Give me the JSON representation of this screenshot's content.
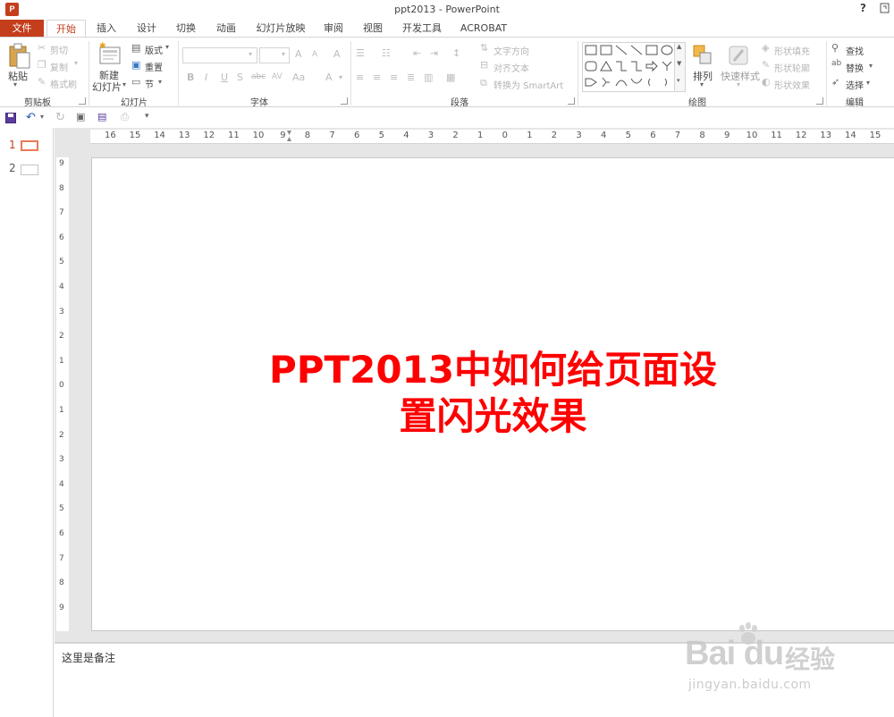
{
  "titlebar": {
    "title": "ppt2013 - PowerPoint",
    "help": "?",
    "app_icon": "P"
  },
  "tabs": [
    {
      "label": "文件"
    },
    {
      "label": "开始"
    },
    {
      "label": "插入"
    },
    {
      "label": "设计"
    },
    {
      "label": "切换"
    },
    {
      "label": "动画"
    },
    {
      "label": "幻灯片放映"
    },
    {
      "label": "审阅"
    },
    {
      "label": "视图"
    },
    {
      "label": "开发工具"
    },
    {
      "label": "ACROBAT"
    }
  ],
  "ribbon": {
    "clipboard": {
      "paste": "粘贴",
      "cut": "剪切",
      "copy": "复制",
      "format_painter": "格式刷",
      "label": "剪贴板"
    },
    "slides": {
      "new_slide_1": "新建",
      "new_slide_2": "幻灯片",
      "layout": "版式",
      "reset": "重置",
      "section": "节",
      "label": "幻灯片"
    },
    "font": {
      "label": "字体",
      "bold": "B",
      "italic": "I",
      "underline": "U",
      "shadow": "S",
      "strike": "abc",
      "spacing": "AV",
      "case": "Aa",
      "font_color": "A",
      "grow": "A",
      "shrink": "A",
      "clear": "A"
    },
    "paragraph": {
      "label": "段落",
      "text_direction": "文字方向",
      "align_text": "对齐文本",
      "smartart": "转换为 SmartArt"
    },
    "drawing": {
      "label": "绘图",
      "arrange": "排列",
      "quick_styles": "快速样式",
      "shape_fill": "形状填充",
      "shape_outline": "形状轮廓",
      "shape_effects": "形状效果"
    },
    "editing": {
      "label": "编辑",
      "find": "查找",
      "replace": "替换",
      "select": "选择"
    }
  },
  "thumbnails": [
    {
      "num": "1"
    },
    {
      "num": "2"
    }
  ],
  "ruler": {
    "h_labels": [
      "16",
      "15",
      "14",
      "13",
      "12",
      "11",
      "10",
      "9",
      "8",
      "7",
      "6",
      "5",
      "4",
      "3",
      "2",
      "1",
      "0",
      "1",
      "2",
      "3",
      "4",
      "5",
      "6",
      "7",
      "8",
      "9",
      "10",
      "11",
      "12",
      "13",
      "14",
      "15"
    ],
    "v_labels": [
      "9",
      "8",
      "7",
      "6",
      "5",
      "4",
      "3",
      "2",
      "1",
      "0",
      "1",
      "2",
      "3",
      "4",
      "5",
      "6",
      "7",
      "8",
      "9"
    ]
  },
  "slide": {
    "title_line1": "PPT2013中如何给页面设",
    "title_line2": "置闪光效果",
    "title_color": "#ff0000"
  },
  "notes": {
    "text": "这里是备注"
  },
  "watermark": {
    "logo": "Bai du",
    "cn": "经验",
    "url": "jingyan.baidu.com"
  },
  "colors": {
    "accent": "#c43e1c"
  }
}
